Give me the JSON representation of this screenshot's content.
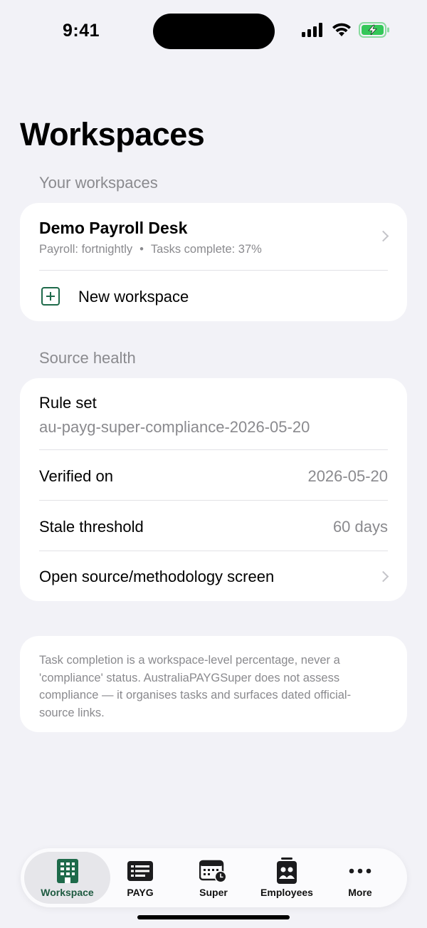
{
  "status_bar": {
    "time": "9:41"
  },
  "page": {
    "title": "Workspaces"
  },
  "workspaces_section": {
    "header": "Your workspaces",
    "workspace": {
      "name": "Demo Payroll Desk",
      "payroll": "Payroll: fortnightly",
      "separator": "•",
      "tasks": "Tasks complete: 37%"
    },
    "new_workspace_label": "New workspace"
  },
  "source_health": {
    "header": "Source health",
    "rule_set_label": "Rule set",
    "rule_set_value": "au-payg-super-compliance-2026-05-20",
    "verified_label": "Verified on",
    "verified_value": "2026-05-20",
    "stale_label": "Stale threshold",
    "stale_value": "60 days",
    "open_source_label": "Open source/methodology screen"
  },
  "note": {
    "text": "Task completion is a workspace-level percentage, never a 'compliance' status. AustraliaPAYGSuper does not assess compliance — it organises tasks and surfaces dated official-source links."
  },
  "tabbar": {
    "tabs": [
      {
        "label": "Workspace",
        "icon": "building-icon",
        "active": true
      },
      {
        "label": "PAYG",
        "icon": "list-card-icon",
        "active": false
      },
      {
        "label": "Super",
        "icon": "calendar-clock-icon",
        "active": false
      },
      {
        "label": "Employees",
        "icon": "people-badge-icon",
        "active": false
      },
      {
        "label": "More",
        "icon": "ellipsis-icon",
        "active": false
      }
    ]
  },
  "colors": {
    "background": "#f2f2f7",
    "accent_green": "#1e6a4a",
    "secondary_text": "#8a8a8e",
    "battery_green": "#34c759"
  }
}
